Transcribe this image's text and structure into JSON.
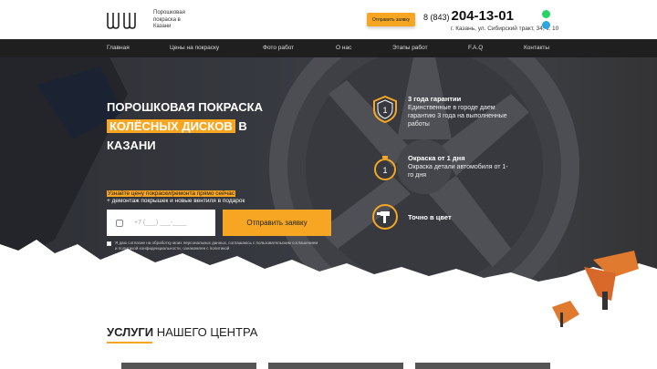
{
  "header": {
    "logo_text": "Порошковая покраска в Казани",
    "callback_label": "Отправить заявку",
    "phone_prefix": "8 (843)",
    "phone_number": "204-13-01",
    "address": "г. Казань, ул. Сибирский тракт, 34, к. 10",
    "icons": [
      "whatsapp-icon",
      "telegram-icon"
    ]
  },
  "nav": {
    "items": [
      "Главная",
      "Цены на покраску",
      "Фото работ",
      "О нас",
      "Этапы работ",
      "F.A.Q",
      "Контакты"
    ]
  },
  "hero": {
    "title_line1": "ПОРОШКОВАЯ ПОКРАСКА",
    "title_highlight": "КОЛЁСНЫХ ДИСКОВ",
    "title_line2_suffix": "В",
    "title_line3": "КАЗАНИ",
    "promo_highlight": "Узнайте цену покраски/ремонта прямо сейчас",
    "promo_rest": "+ демонтаж покрышек и новые вентиля в подарок",
    "phone_placeholder": "+7 (___) ___-____",
    "submit_label": "Отправить заявку",
    "consent": "Я даю согласие на обработку моих персональных данных, соглашаюсь с пользовательским соглашением и политикой конфиденциальности, ознакомлен с политикой"
  },
  "features": [
    {
      "icon": "shield-badge-icon",
      "title": "3 года гарантии",
      "desc": "Единственные в городе даем гарантию 3 года на выполненные работы"
    },
    {
      "icon": "stopwatch-icon",
      "title": "Окраска от 1 дня",
      "desc": "Окраска детали автомобиля от 1-го дня"
    },
    {
      "icon": "spray-gun-icon",
      "title": "Точно в цвет",
      "desc": ""
    }
  ],
  "services": {
    "title_bold": "УСЛУГИ",
    "title_rest": "НАШЕГО ЦЕНТРА"
  },
  "colors": {
    "accent": "#f6a623",
    "nav_bg": "#1f1f1f"
  }
}
